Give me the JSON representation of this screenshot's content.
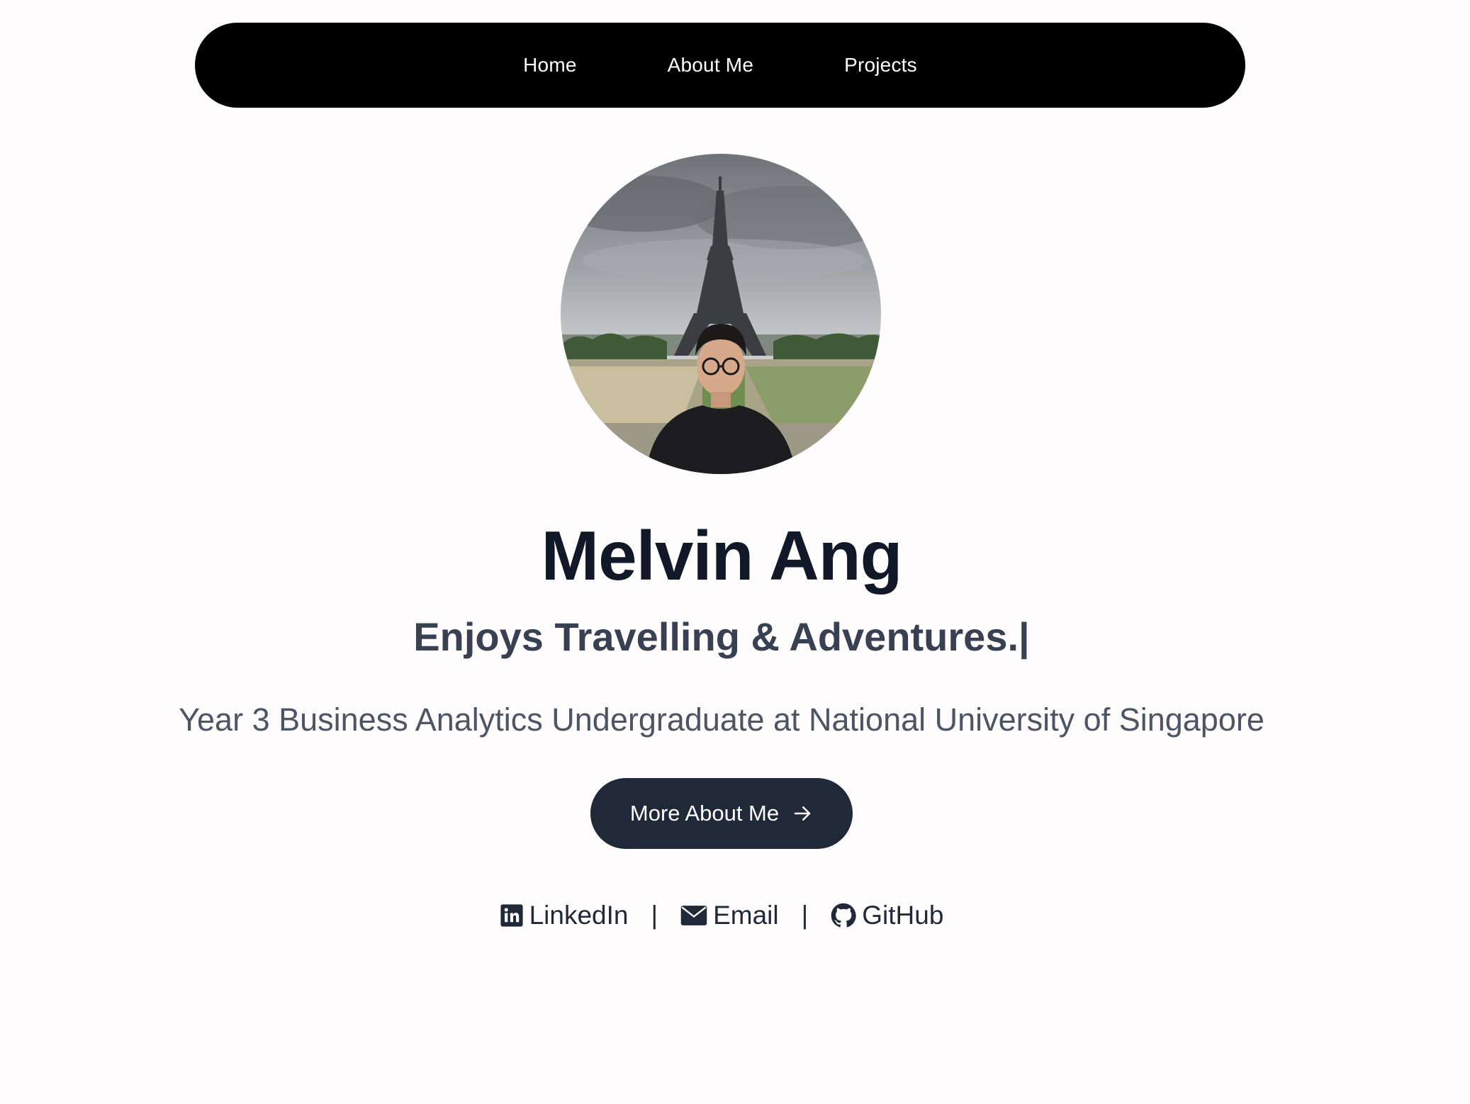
{
  "nav": {
    "items": [
      {
        "label": "Home"
      },
      {
        "label": "About Me"
      },
      {
        "label": "Projects"
      }
    ]
  },
  "hero": {
    "name": "Melvin Ang",
    "tagline": "Enjoys Travelling & Adventures.|",
    "subtitle": "Year 3 Business Analytics Undergraduate at National University of Singapore",
    "cta_label": "More About Me"
  },
  "socials": {
    "linkedin": "LinkedIn",
    "email": "Email",
    "github": "GitHub",
    "separator": "|"
  },
  "colors": {
    "background": "#fffcfd",
    "nav_bg": "#000000",
    "heading": "#111827",
    "tagline": "#374151",
    "subtitle": "#4b5563",
    "button_bg": "#1f2937"
  }
}
